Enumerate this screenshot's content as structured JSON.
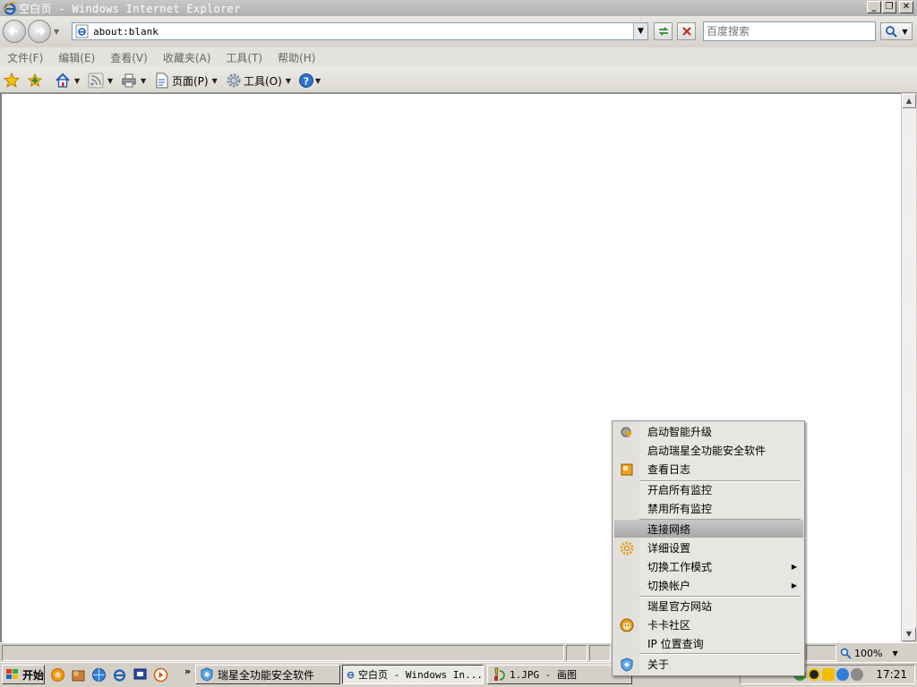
{
  "window": {
    "title": "空白页 - Windows Internet Explorer"
  },
  "toolbar": {
    "address_value": "about:blank",
    "search_placeholder": "百度搜索"
  },
  "menu": {
    "items": [
      "文件(F)",
      "编辑(E)",
      "查看(V)",
      "收藏夹(A)",
      "工具(T)",
      "帮助(H)"
    ]
  },
  "command_bar": {
    "page_label": "页面(P)",
    "tools_label": "工具(O)"
  },
  "status": {
    "zoom": "100%"
  },
  "taskbar": {
    "start_label": "开始",
    "tasks": [
      {
        "label": "瑞星全功能安全软件",
        "icon": "rising-shield-icon"
      },
      {
        "label": "空白页 - Windows In...",
        "icon": "ie-icon"
      },
      {
        "label": "1.JPG - 画图",
        "icon": "paint-icon"
      }
    ],
    "clock": "17:21"
  },
  "context_menu": {
    "items": [
      {
        "label": "启动智能升级",
        "icon": "upgrade-icon"
      },
      {
        "label": "启动瑞星全功能安全软件"
      },
      {
        "label": "查看日志",
        "icon": "log-icon"
      },
      {
        "label": "开启所有监控"
      },
      {
        "label": "禁用所有监控"
      },
      {
        "label": "连接网络",
        "highlighted": true
      },
      {
        "label": "详细设置",
        "icon": "settings-gear-icon"
      },
      {
        "label": "切换工作模式",
        "submenu": true
      },
      {
        "label": "切换帐户",
        "submenu": true
      },
      {
        "label": "瑞星官方网站"
      },
      {
        "label": "卡卡社区",
        "icon": "kaka-lion-icon"
      },
      {
        "label": "IP 位置查询"
      },
      {
        "label": "关于",
        "icon": "rising-shield-icon"
      }
    ]
  },
  "colors": {
    "window_frame": "#d4d0c8",
    "titlebar": "#b8b8b8",
    "menu_highlight": "#b0b0b0",
    "link_blue": "#1a5fb4"
  }
}
